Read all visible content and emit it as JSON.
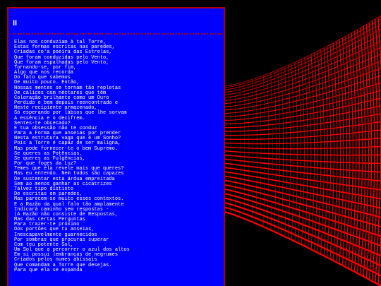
{
  "page": {
    "background_color": "#000000",
    "panel_color": "#0000ff",
    "panel_border_color": "#b00000",
    "text_color": "#ffffff"
  },
  "panel": {
    "heading": "II",
    "poem_lines": [
      "Elas nos conduziam à tal Torre,",
      "Estas formas escritas nas paredes,",
      "Criadas co'a poeira das Estrelas,",
      "Que foram conduzidas pelo Vento,",
      "Que foram espalhadas pelo Vento,",
      "Tornando-se, por fim,",
      "Algo que nos recorda",
      "Do fato que sabemos",
      "De muito pouco. Então,",
      "Nossas mentes se tornam tão repletas",
      "De cálices com néctares que têm",
      "Coloração brilhante como um Ouro",
      "Perdido e bem depois reencontrado e",
      "Neste recipiente armazenado,",
      "Só esperando por lábios que lhe sorvam",
      "A essência e o decifrem.",
      "Sentes-te obcecado?",
      "E tua obsessão não te conduz",
      "Para a Forma que anseias por prender",
      "Nesta estrutura vaga que é um Sonho?",
      "Pois a Torre é capaz de ser maligna,",
      "Mas pode fornecer-te o bem Supremo.",
      "Se queres as Potências,",
      "Se queres as Fulgências,",
      "Por que foges da Luz?",
      "Temes que ela revele mais que queres?",
      "Mas eu entendo. Nem todos são capazes",
      "De sustentar esta árdua empreitada",
      "Sem ao menos ganhar as cicatrizes",
      "Talvez tipo distinto",
      "De escritas em paredes,",
      "Mas parecem-se muito esses contextos.",
      "E a Razão da qual falo tão amplamente",
      "Indicará caminho sem respostas -",
      "(A Razão não consiste de Respostas,",
      "Mas das certas Perguntas",
      "Para trazer-te próximo",
      "Dos portões que tu anseias,",
      "Inescapavelmente guarnecidos",
      "Por sombras que procuras superar",
      "Com teu potente Sol,",
      "Um Sol que a percorrer o azul dos altos",
      "Em si possui lembranças de negrumes",
      "Criados pelos numes abissais",
      "Que comandam a Torre que desejas.",
      "Para que ela se expanda"
    ]
  },
  "background_art": {
    "icon": "red-grid-tower-image",
    "grid_color": "#ff0000"
  }
}
